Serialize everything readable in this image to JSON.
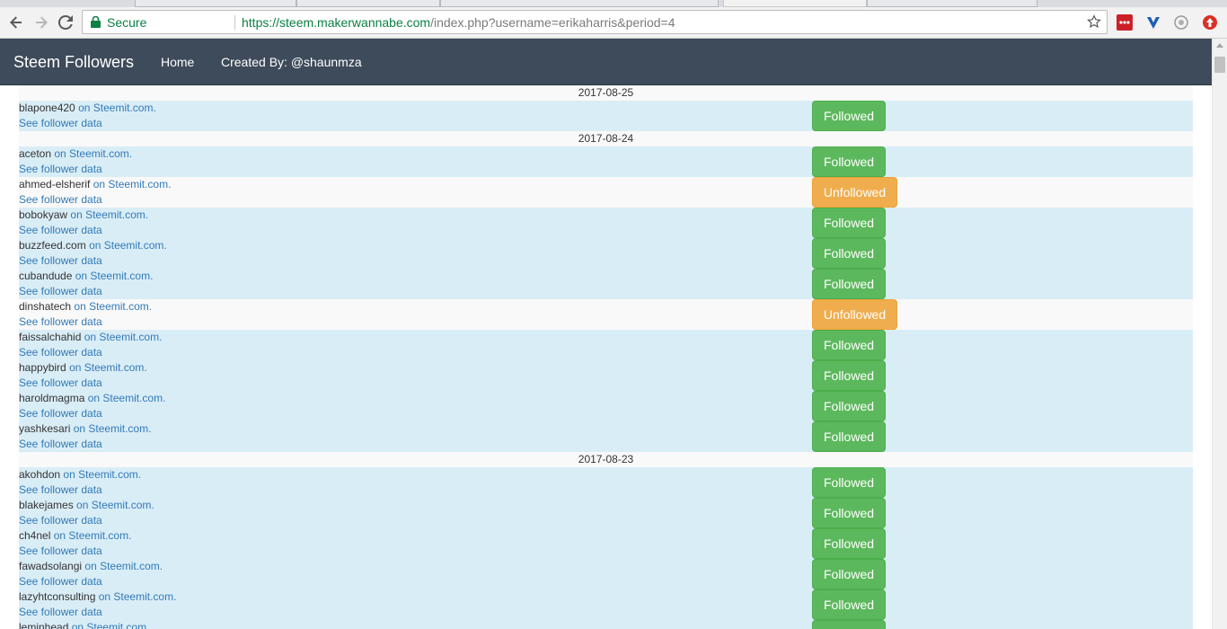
{
  "browser": {
    "secure_label": "Secure",
    "url_host": "https://steem.makerwannabe.com",
    "url_rest": "/index.php?username=erikaharris&period=4",
    "icons": [
      "back-arrow-icon",
      "forward-arrow-icon",
      "reload-icon",
      "lock-icon",
      "star-icon"
    ],
    "extensions": [
      "lastpass-icon",
      "vivaldi-v-icon",
      "privacy-icon",
      "upvote-icon"
    ]
  },
  "navbar": {
    "brand": "Steem Followers",
    "home": "Home",
    "created_by": "Created By: @shaunmza"
  },
  "labels": {
    "on_site": "on Steemit.com.",
    "see_data": "See follower data",
    "followed": "Followed",
    "unfollowed": "Unfollowed"
  },
  "groups": [
    {
      "date": "2017-08-25",
      "entries": [
        {
          "user": "blapone420",
          "status": "Followed"
        }
      ]
    },
    {
      "date": "2017-08-24",
      "entries": [
        {
          "user": "aceton",
          "status": "Followed"
        },
        {
          "user": "ahmed-elsherif",
          "status": "Unfollowed"
        },
        {
          "user": "bobokyaw",
          "status": "Followed"
        },
        {
          "user": "buzzfeed.com",
          "status": "Followed"
        },
        {
          "user": "cubandude",
          "status": "Followed"
        },
        {
          "user": "dinshatech",
          "status": "Unfollowed"
        },
        {
          "user": "faissalchahid",
          "status": "Followed"
        },
        {
          "user": "happybird",
          "status": "Followed"
        },
        {
          "user": "haroldmagma",
          "status": "Followed"
        },
        {
          "user": "yashkesari",
          "status": "Followed"
        }
      ]
    },
    {
      "date": "2017-08-23",
      "entries": [
        {
          "user": "akohdon",
          "status": "Followed"
        },
        {
          "user": "blakejames",
          "status": "Followed"
        },
        {
          "user": "ch4nel",
          "status": "Followed"
        },
        {
          "user": "fawadsolangi",
          "status": "Followed"
        },
        {
          "user": "lazyhtconsulting",
          "status": "Followed"
        },
        {
          "user": "leminhead",
          "status": "Followed"
        }
      ]
    }
  ],
  "colors": {
    "navbar": "#3d4b5a",
    "followed": "#5cb85c",
    "unfollowed": "#f0ad4e",
    "row_info": "#d9edf7",
    "link": "#337ab7"
  }
}
